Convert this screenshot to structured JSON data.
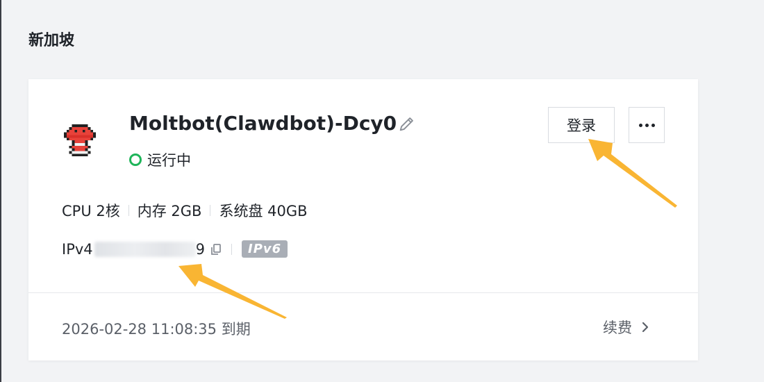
{
  "region": {
    "title": "新加坡"
  },
  "instance": {
    "name": "Moltbot(Clawdbot)-Dcy0",
    "status": "运行中",
    "status_color": "#1fb55a",
    "avatar_icon": "red-pixel-robot-icon",
    "actions": {
      "login": "登录",
      "more_icon": "more-dots-icon"
    },
    "specs": {
      "cpu": "CPU 2核",
      "memory": "内存 2GB",
      "disk": "系统盘 40GB"
    },
    "ipv4": {
      "prefix": "IPv4",
      "tail": "9",
      "copy_icon": "copy-icon"
    },
    "ipv6_badge": "IPv6",
    "expiry": "2026-02-28 11:08:35 到期",
    "renew": "续费"
  },
  "annotation_color": "#f9b533"
}
